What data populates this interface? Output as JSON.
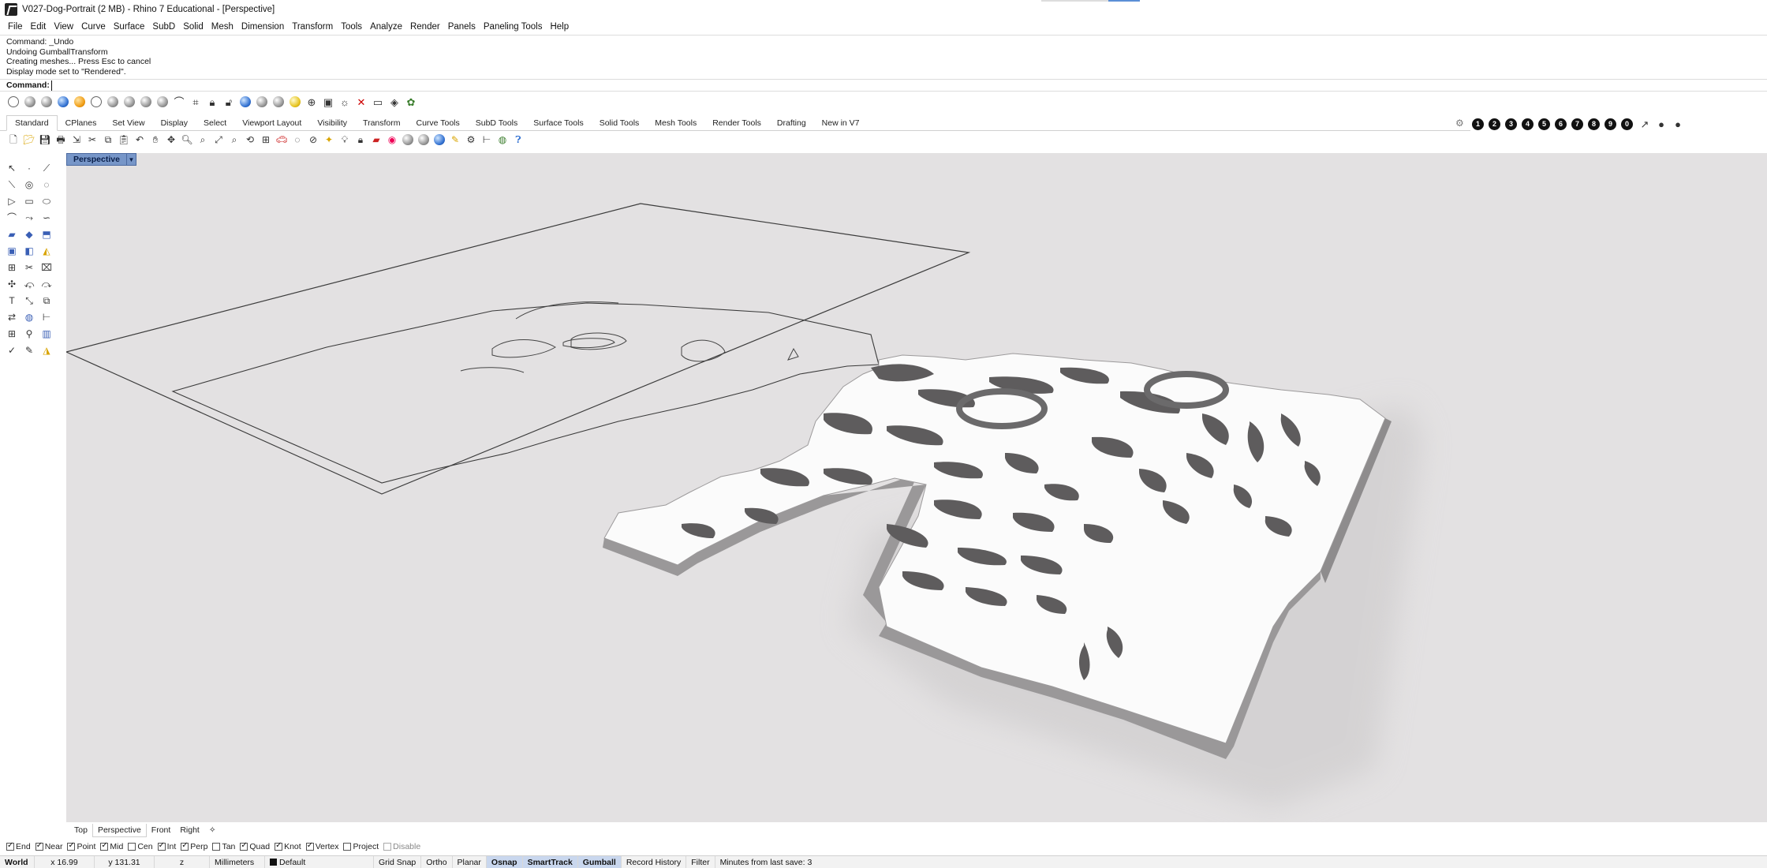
{
  "window": {
    "title": "V027-Dog-Portrait (2 MB) - Rhino 7 Educational - [Perspective]"
  },
  "menu": [
    "File",
    "Edit",
    "View",
    "Curve",
    "Surface",
    "SubD",
    "Solid",
    "Mesh",
    "Dimension",
    "Transform",
    "Tools",
    "Analyze",
    "Render",
    "Panels",
    "Paneling Tools",
    "Help"
  ],
  "command_history": [
    "Command: _Undo",
    "Undoing GumballTransform",
    "Creating meshes... Press Esc to cancel",
    "Display mode set to \"Rendered\"."
  ],
  "command": {
    "prompt": "Command:",
    "value": ""
  },
  "toolbar_tabs": [
    "Standard",
    "CPlanes",
    "Set View",
    "Display",
    "Select",
    "Viewport Layout",
    "Visibility",
    "Transform",
    "Curve Tools",
    "SubD Tools",
    "Surface Tools",
    "Solid Tools",
    "Mesh Tools",
    "Render Tools",
    "Drafting",
    "New in V7"
  ],
  "active_toolbar_tab": "Standard",
  "osnap_numbers": [
    "1",
    "2",
    "3",
    "4",
    "5",
    "6",
    "7",
    "8",
    "9",
    "0"
  ],
  "viewport": {
    "label": "Perspective",
    "background": "#e3e1e2"
  },
  "view_tabs": [
    "Top",
    "Perspective",
    "Front",
    "Right"
  ],
  "active_view_tab": "Perspective",
  "view_tab_add": "✧",
  "osnaps": [
    {
      "label": "End",
      "checked": true
    },
    {
      "label": "Near",
      "checked": true
    },
    {
      "label": "Point",
      "checked": true
    },
    {
      "label": "Mid",
      "checked": true
    },
    {
      "label": "Cen",
      "checked": false
    },
    {
      "label": "Int",
      "checked": true
    },
    {
      "label": "Perp",
      "checked": true
    },
    {
      "label": "Tan",
      "checked": false
    },
    {
      "label": "Quad",
      "checked": true
    },
    {
      "label": "Knot",
      "checked": true
    },
    {
      "label": "Vertex",
      "checked": true
    },
    {
      "label": "Project",
      "checked": false
    },
    {
      "label": "Disable",
      "checked": false
    }
  ],
  "status": {
    "cplane": "World",
    "x": "x 16.99",
    "y": "y 131.31",
    "z": "z",
    "units": "Millimeters",
    "layer": "Default",
    "grid_snap": "Grid Snap",
    "ortho": "Ortho",
    "planar": "Planar",
    "osnap": "Osnap",
    "smarttrack": "SmartTrack",
    "gumball": "Gumball",
    "record_history": "Record History",
    "filter": "Filter",
    "last_save": "Minutes from last save: 3"
  }
}
